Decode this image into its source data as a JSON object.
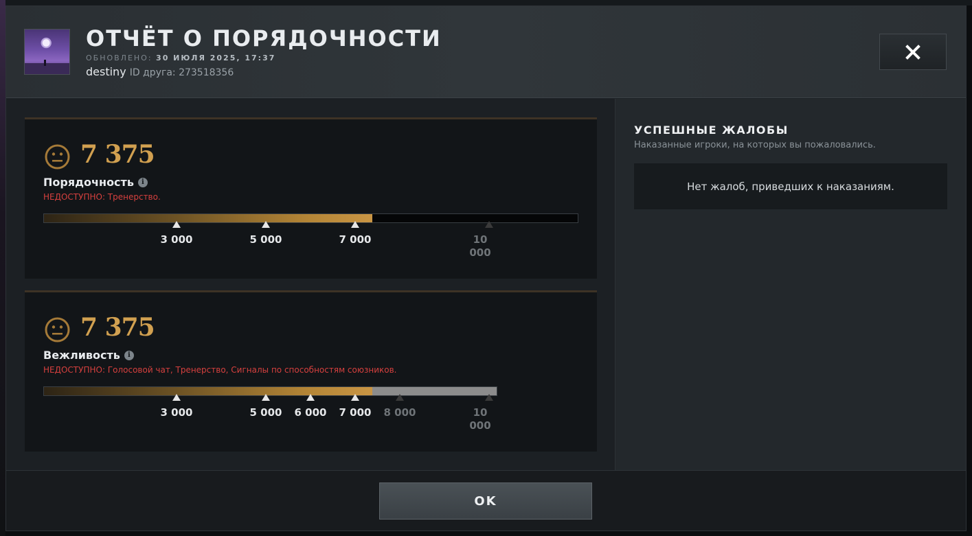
{
  "header": {
    "title": "ОТЧЁТ О ПОРЯДОЧНОСТИ",
    "updated_label": "ОБНОВЛЕНО:",
    "updated_value": "30 ИЮЛЯ 2025, 17:37",
    "player_name": "destiny",
    "friend_id_label": "ID друга: 273518356",
    "close_label": "×"
  },
  "conduct": {
    "score": "7 375",
    "label": "Порядочность",
    "unavailable": "НЕДОСТУПНО:  Тренерство.",
    "progress_fraction": 0.7375,
    "ticks": [
      "3 000",
      "5 000",
      "7 000",
      "10 000"
    ]
  },
  "politeness": {
    "score": "7 375",
    "label": "Вежливость",
    "unavailable": "НЕДОСТУПНО:  Голосовой чат, Тренерство, Сигналы по способностям союзников.",
    "progress_fraction": 0.7375,
    "ticks": [
      "3 000",
      "5 000",
      "6 000",
      "7 000",
      "8 000",
      "10 000"
    ]
  },
  "reports": {
    "title": "УСПЕШНЫЕ ЖАЛОБЫ",
    "subtitle": "Наказанные игроки, на которых вы пожаловались.",
    "empty_text": "Нет жалоб, приведших к наказаниям."
  },
  "footer": {
    "ok_label": "OK"
  },
  "colors": {
    "accent_gold": "#d1a050",
    "warning_red": "#d6403e"
  }
}
